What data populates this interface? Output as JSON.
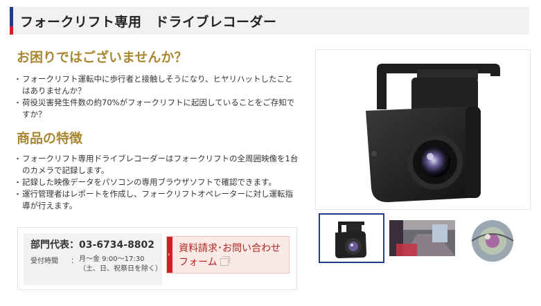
{
  "header": {
    "title": "フォークリフト専用　ドライブレコーダー"
  },
  "problems": {
    "heading": "お困りではございませんか？",
    "items": [
      "フォークリフト運転中に歩行者と接触しそうになり、ヒヤリハットしたことはありませんか？",
      "荷役災害発生件数の約70%がフォークリフトに起因していることをご存知ですか？"
    ]
  },
  "features": {
    "heading": "商品の特徴",
    "items": [
      "フォークリフト専用ドライブレコーダーはフォークリフトの全周囲映像を1台のカメラで記録します。",
      "記録した映像データをパソコンの専用ブラウザソフトで確認できます。",
      "運行管理者はレポートを作成し、フォークリフトオペレーターに対し運転指導が行えます。"
    ]
  },
  "contact": {
    "phone_line": "部門代表：03-6734-8802",
    "hours_label": "受付時間",
    "hours_colon": "：",
    "hours_text": "月〜金 9:00〜17:30（土、日、祝祭日を除く）",
    "form_button_label": "資料請求･お問い合わせフォーム"
  },
  "gallery": {
    "selected_index": 0,
    "thumbnails": [
      "camera-product-photo",
      "forklift-cabin-view",
      "fisheye-view"
    ]
  },
  "colors": {
    "accent_blue": "#1e3d8f",
    "accent_red": "#d91c24",
    "heading_gold": "#a8872f"
  }
}
